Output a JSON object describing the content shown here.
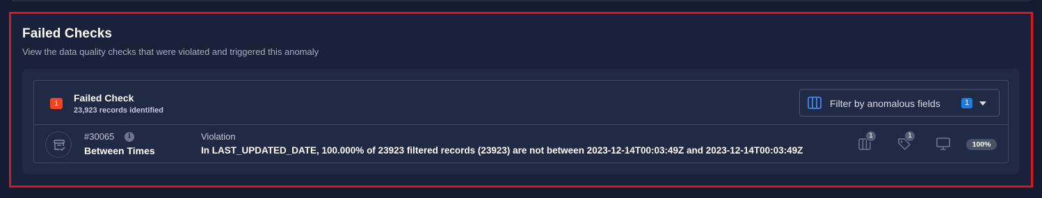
{
  "section": {
    "title": "Failed Checks",
    "subtitle": "View the data quality checks that were violated and triggered this anomaly"
  },
  "header": {
    "count_badge": "1",
    "title": "Failed Check",
    "records": "23,923 records identified",
    "filter": {
      "label": "Filter by anomalous fields",
      "count": "1",
      "icon": "columns-icon"
    }
  },
  "rows": [
    {
      "id": "#30065",
      "name": "Between Times",
      "violation_label": "Violation",
      "violation_text": "In LAST_UPDATED_DATE, 100.000% of 23923 filtered records (23923) are not between 2023-12-14T00:03:49Z and 2023-12-14T00:03:49Z",
      "fields_count": "1",
      "tags_count": "1",
      "coverage": "100%"
    }
  ],
  "colors": {
    "background": "#141c33",
    "section": "#19213b",
    "panel": "#212a45",
    "highlight": "#e0141c",
    "badge_red": "#f0451e",
    "badge_blue": "#1b7de8"
  }
}
